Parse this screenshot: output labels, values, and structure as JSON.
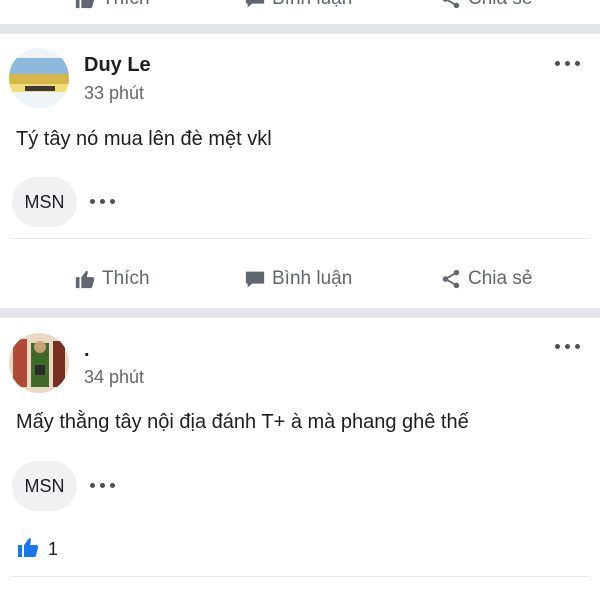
{
  "top_actions": {
    "like": "Thích",
    "comment": "Bình luận",
    "share": "Chia sẻ"
  },
  "posts": [
    {
      "author": "Duy Le",
      "time": "33 phút",
      "text": "Tý tây nó mua lên đè mệt vkl",
      "tag": "MSN",
      "actions": {
        "like": "Thích",
        "comment": "Bình luận",
        "share": "Chia sẻ"
      }
    },
    {
      "author": ".",
      "time": "34 phút",
      "text": "Mấy thằng tây nội địa đánh T+ à mà phang ghê thế",
      "tag": "MSN",
      "reaction_count": "1"
    }
  ],
  "colors": {
    "like_blue": "#1877f2",
    "separator": "#e4e6eb",
    "muted": "#65676b"
  },
  "icons": [
    "thumbs-up-icon",
    "comment-icon",
    "share-icon",
    "more-icon"
  ]
}
